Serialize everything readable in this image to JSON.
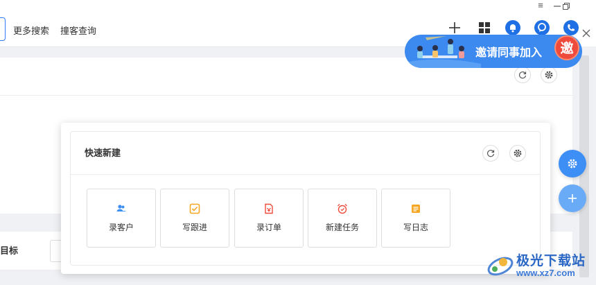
{
  "window": {
    "menu_icon": "hamburger-icon",
    "minimize_icon": "minimize-icon",
    "restore_icon": "restore-icon"
  },
  "toolbar": {
    "more_search": "更多搜索",
    "collision_check": "撞客查询",
    "icons": [
      "plus-icon",
      "apps-grid-icon",
      "bell-icon",
      "chat-icon",
      "phone-icon"
    ]
  },
  "banner": {
    "text": "邀请同事加入",
    "badge": "邀",
    "close_icon": "close-icon",
    "colors": {
      "background": "#3c8af0",
      "badge": "#ef4b3c"
    }
  },
  "background_section": {
    "partial_label": "目标"
  },
  "quick_create": {
    "title": "快速新建",
    "items": [
      {
        "label": "录客户",
        "icon": "customer-icon",
        "color": "#3d8ef5"
      },
      {
        "label": "写跟进",
        "icon": "checkbox-icon",
        "color": "#f5a623"
      },
      {
        "label": "录订单",
        "icon": "order-icon",
        "color": "#ef4b3c"
      },
      {
        "label": "新建任务",
        "icon": "alarm-clock-icon",
        "color": "#ef4b3c"
      },
      {
        "label": "写日志",
        "icon": "notes-icon",
        "color": "#f5a623"
      }
    ]
  },
  "fabs": {
    "settings_icon": "gear-icon",
    "add_icon": "plus-icon",
    "colors": {
      "settings": "#3d8ef5",
      "add": "#6aabf7"
    }
  },
  "watermark": {
    "name": "极光下载站",
    "url": "www.xz7.com"
  }
}
